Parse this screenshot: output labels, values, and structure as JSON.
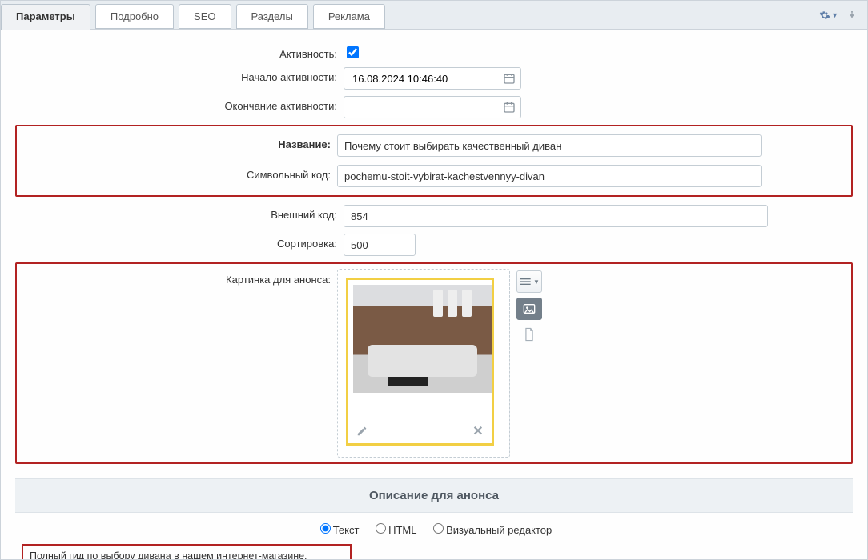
{
  "tabs": {
    "params": "Параметры",
    "detail": "Подробно",
    "seo": "SEO",
    "sections": "Разделы",
    "ads": "Реклама"
  },
  "labels": {
    "active": "Активность:",
    "start": "Начало активности:",
    "end": "Окончание активности:",
    "name": "Название:",
    "code": "Символьный код:",
    "external": "Внешний код:",
    "sort": "Сортировка:",
    "preview_picture": "Картинка для анонса:"
  },
  "values": {
    "start": "16.08.2024 10:46:40",
    "end": "",
    "name": "Почему стоит выбирать качественный диван",
    "code": "pochemu-stoit-vybirat-kachestvennyy-divan",
    "external": "854",
    "sort": "500"
  },
  "section_heading": "Описание для анонса",
  "editor_modes": {
    "text": "Текст",
    "html": "HTML",
    "visual": "Визуальный редактор"
  },
  "announcement_text": "Полный гид по выбору дивана в нашем интернет-магазине."
}
